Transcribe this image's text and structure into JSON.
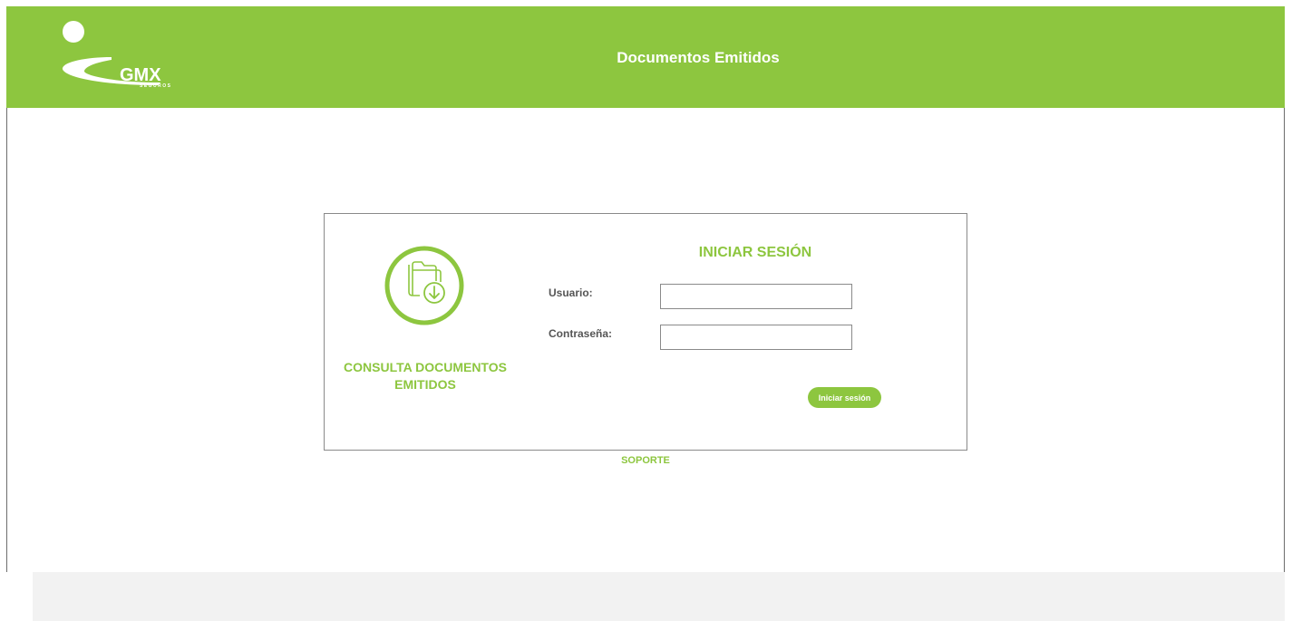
{
  "header": {
    "logo": {
      "brand": "GMX",
      "sub": "SEGUROS",
      "icon": "gmx-logo"
    },
    "title": "Documentos Emitidos"
  },
  "left_panel": {
    "icon": "folder-download-icon",
    "caption": "CONSULTA DOCUMENTOS EMITIDOS"
  },
  "login": {
    "title": "INICIAR SESIÓN",
    "username_label": "Usuario:",
    "username_value": "",
    "password_label": "Contraseña:",
    "password_value": "",
    "submit_label": "Iniciar sesión"
  },
  "support": {
    "label": "SOPORTE"
  },
  "colors": {
    "brand_green": "#8dc63f",
    "footer_gray": "#f2f2f2",
    "border_gray": "#8a8a8a"
  }
}
